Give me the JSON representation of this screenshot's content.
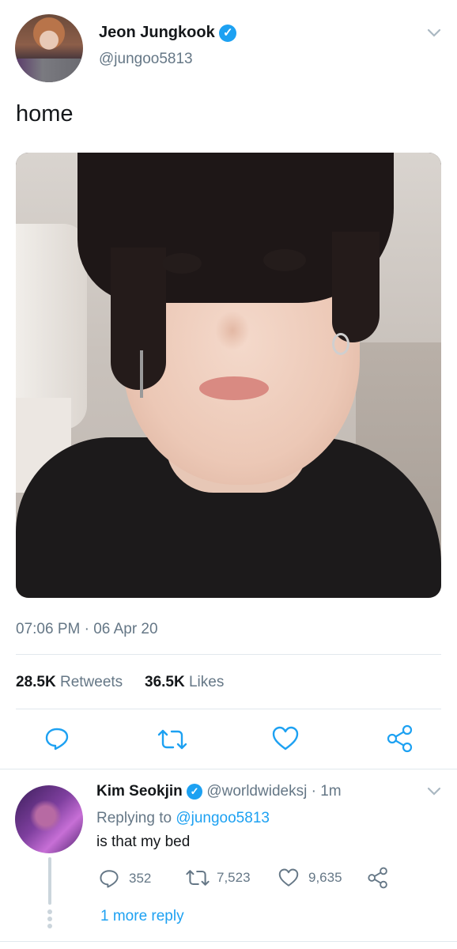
{
  "tweet": {
    "author_name": "Jeon Jungkook",
    "author_handle": "@jungoo5813",
    "text": "home",
    "timestamp": "07:06 PM · 06 Apr 20",
    "retweets_count": "28.5K",
    "retweets_label": "Retweets",
    "likes_count": "36.5K",
    "likes_label": "Likes",
    "icons": [
      "reply-icon",
      "retweet-icon",
      "like-icon",
      "share-icon"
    ]
  },
  "reply": {
    "author_name": "Kim Seokjin",
    "author_handle": "@worldwideksj",
    "time": "· 1m",
    "replying_prefix": "Replying to",
    "replying_handle": "@jungoo5813",
    "text": "is that my bed",
    "reply_count": "352",
    "retweet_count": "7,523",
    "like_count": "9,635",
    "more_replies": "1 more reply"
  },
  "colors": {
    "accent": "#1da1f2",
    "muted_text": "#657786",
    "divider": "#e1e8ed"
  }
}
